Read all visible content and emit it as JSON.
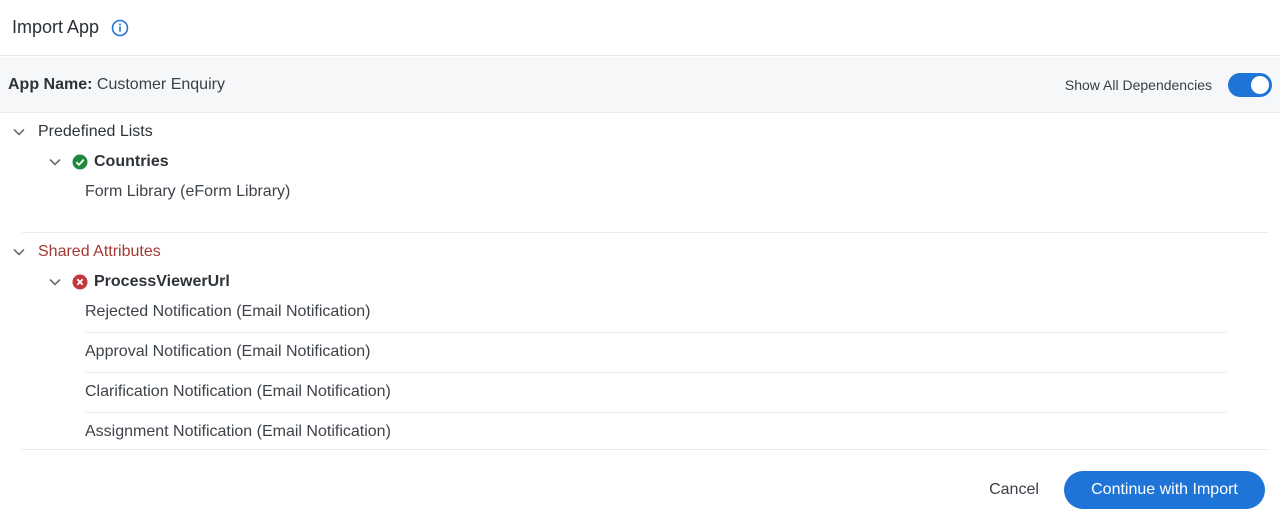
{
  "header": {
    "title": "Import App",
    "info_icon": "info-circle-icon",
    "accent": "#1f74d8"
  },
  "app_bar": {
    "label": "App Name:",
    "app_name": "Customer Enquiry",
    "toggle_label": "Show All Dependencies",
    "toggle_on": true
  },
  "groups": [
    {
      "label": "Predefined Lists",
      "status": "ok",
      "items": [
        {
          "name": "Countries",
          "status_icon": "check-circle-icon",
          "dependencies": [
            "Form Library (eForm Library)"
          ]
        }
      ]
    },
    {
      "label": "Shared Attributes",
      "status": "error",
      "items": [
        {
          "name": "ProcessViewerUrl",
          "status_icon": "x-circle-icon",
          "dependencies": [
            "Rejected Notification (Email Notification)",
            "Approval Notification (Email Notification)",
            "Clarification Notification (Email Notification)",
            "Assignment Notification (Email Notification)"
          ]
        }
      ]
    }
  ],
  "footer": {
    "cancel_label": "Cancel",
    "continue_label": "Continue with Import"
  },
  "colors": {
    "success": "#1f8a3c",
    "error": "#c0383a",
    "primary": "#1f74d8"
  }
}
